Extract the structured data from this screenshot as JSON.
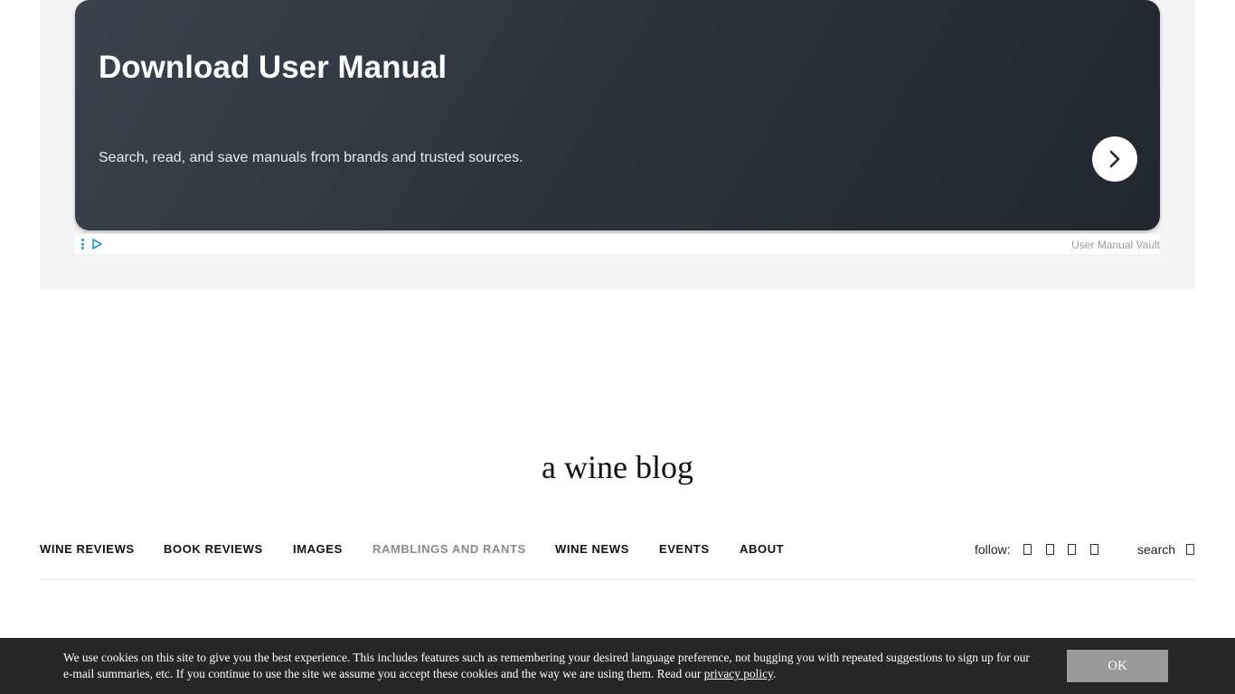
{
  "ad": {
    "title": "Download User Manual",
    "description": "Search, read, and save manuals from brands and trusted sources.",
    "source": "User Manual Vault",
    "arrow_icon": "chevron-right-icon",
    "adchoices_icon": "adchoices-play-icon",
    "gradient_start": "#3a424d",
    "gradient_end": "#22262e"
  },
  "blog": {
    "title": "a wine blog"
  },
  "nav": {
    "items": [
      {
        "label": "WINE REVIEWS"
      },
      {
        "label": "BOOK REVIEWS"
      },
      {
        "label": "IMAGES"
      },
      {
        "label": "RAMBLINGS AND RANTS"
      },
      {
        "label": "WINE NEWS"
      },
      {
        "label": "EVENTS"
      },
      {
        "label": "ABOUT"
      }
    ],
    "active_color": "#8a8a8a",
    "follow_label": "follow:",
    "social_icons": [
      "social-icon-1",
      "social-icon-2",
      "social-icon-3",
      "social-icon-4"
    ],
    "search_label": "search"
  },
  "cookie": {
    "text": "We use cookies on this site to give you the best experience. This includes features such as remembering your desired language preference, not bugging you with repeated suggestions to sign up for our e-mail summaries, etc. If you continue to use the site we assume you accept these cookies and the way we are using them. Read our ",
    "link_text": "privacy policy",
    "text_end": ".",
    "ok_label": "OK",
    "background": "#262626",
    "button_color": "#9a9a9a"
  }
}
